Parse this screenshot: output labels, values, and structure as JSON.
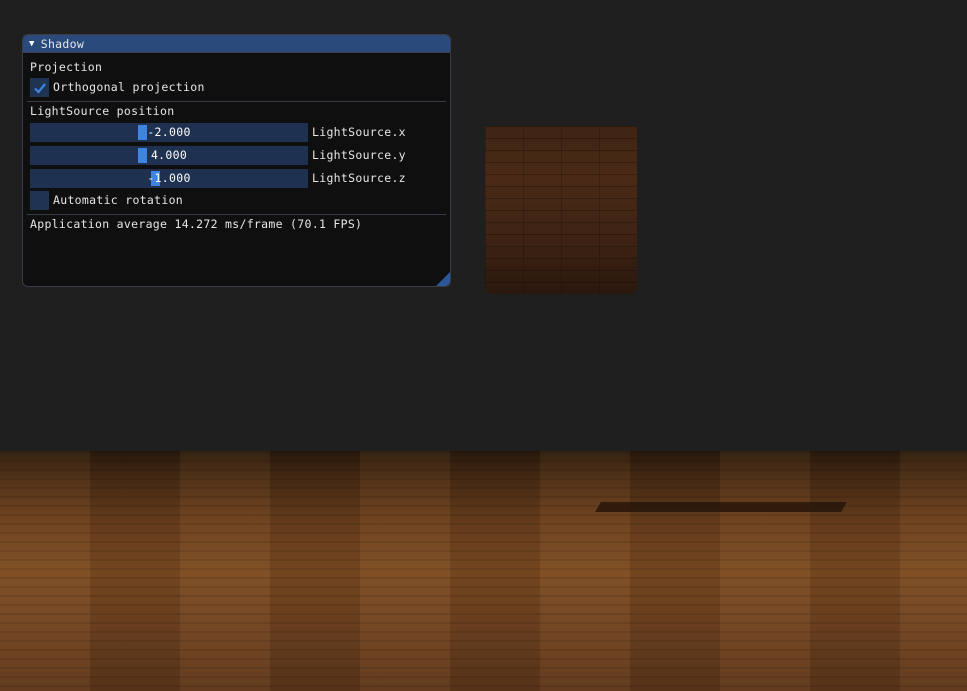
{
  "scene": {
    "colors": {
      "wall": "#1f1f1f",
      "floor": "#6a3f1d",
      "crate": "#4a2a16"
    }
  },
  "window": {
    "title": "Shadow",
    "collapse_icon": "triangle-down-icon",
    "projection": {
      "header": "Projection",
      "ortho_label": "Orthogonal projection",
      "ortho_checked": true
    },
    "light": {
      "header": "LightSource position",
      "sliders": [
        {
          "label": "LightSource.x",
          "value": "-2.000",
          "fraction": 0.4
        },
        {
          "label": "LightSource.y",
          "value": "4.000",
          "fraction": 0.4
        },
        {
          "label": "LightSource.z",
          "value": "-1.000",
          "fraction": 0.45
        }
      ],
      "auto_rotation_label": "Automatic rotation",
      "auto_rotation_checked": false
    },
    "status": "Application average 14.272 ms/frame (70.1 FPS)",
    "colors": {
      "title_bg": "#294a7a",
      "frame_bg": "#1e3150",
      "accent": "#3d85e0"
    }
  }
}
